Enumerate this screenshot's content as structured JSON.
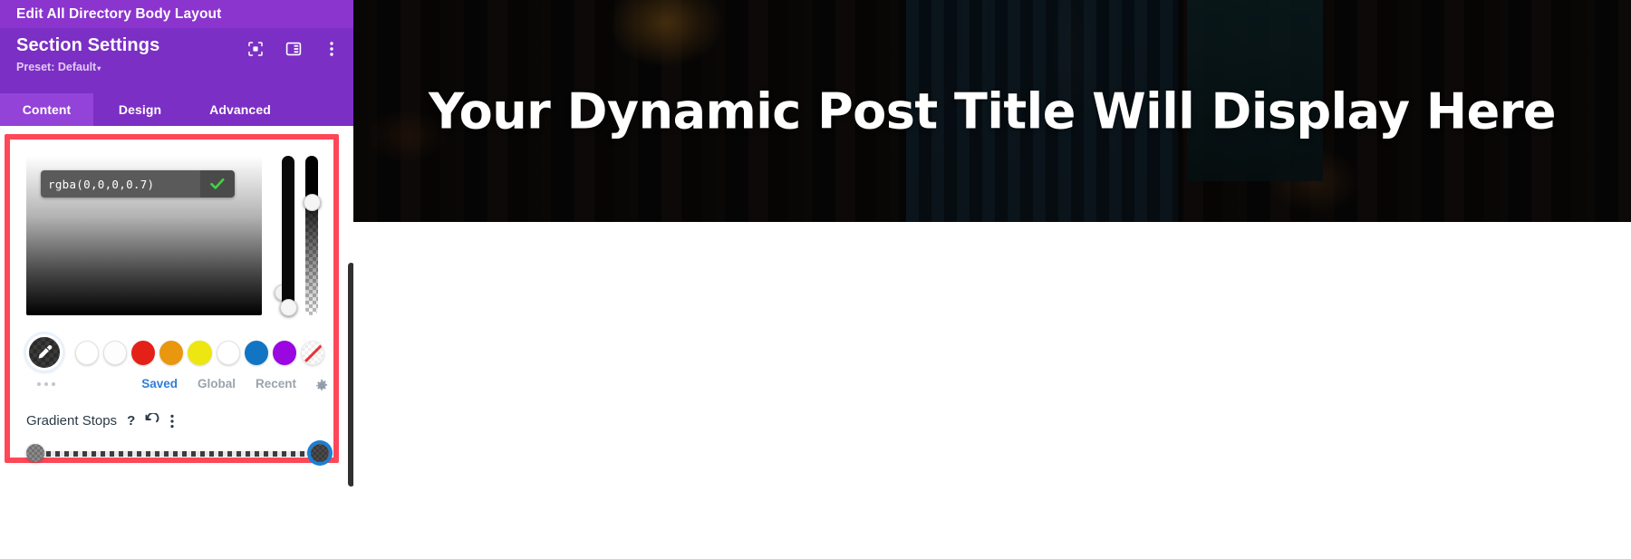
{
  "titlebar": {
    "title": "Edit All Directory Body Layout"
  },
  "panel_header": {
    "heading": "Section Settings",
    "preset": "Preset: Default",
    "caret": "▾",
    "icons": [
      {
        "name": "focus-target-icon"
      },
      {
        "name": "panel-layout-icon"
      },
      {
        "name": "kebab-menu-icon"
      }
    ]
  },
  "tabs": [
    {
      "label": "Content",
      "active": true
    },
    {
      "label": "Design",
      "active": false
    },
    {
      "label": "Advanced",
      "active": false
    }
  ],
  "color_picker": {
    "value": "rgba(0,0,0,0.7)",
    "placeholder": "rgba(0,0,0,0.7)",
    "confirm_icon": "green-checkmark-icon",
    "confirm_color": "#3FD43F",
    "eyedropper_icon": "eyedropper-icon",
    "hue_slider_label": "hue-slider",
    "alpha_slider_label": "alpha-slider",
    "swatches": [
      {
        "name": "swatch-white-1",
        "color": "#ffffff"
      },
      {
        "name": "swatch-white-2",
        "color": "#fdfdfd"
      },
      {
        "name": "swatch-red",
        "color": "#E32119"
      },
      {
        "name": "swatch-orange",
        "color": "#E8970F"
      },
      {
        "name": "swatch-yellow",
        "color": "#EDE611"
      },
      {
        "name": "swatch-white-3",
        "color": "#ffffff"
      },
      {
        "name": "swatch-blue",
        "color": "#1175C4"
      },
      {
        "name": "swatch-purple",
        "color": "#9A07E0"
      }
    ],
    "no_color_swatch": "no-color-swatch",
    "more_dots": "more-options-dots",
    "palette_tabs": [
      {
        "label": "Saved",
        "active": true
      },
      {
        "label": "Global",
        "active": false
      },
      {
        "label": "Recent",
        "active": false
      }
    ],
    "gear_icon": "settings-gear-icon",
    "active_tab_color": "#2F7ED8"
  },
  "gradient_stops": {
    "label": "Gradient Stops",
    "help_icon": "?",
    "reset_icon": "reset-undo-icon",
    "menu_icon": "kebab-menu-icon",
    "stops": [
      {
        "name": "gradient-stop-start",
        "position": 0,
        "selected": false
      },
      {
        "name": "gradient-stop-end",
        "position": 100,
        "selected": true
      }
    ],
    "selected_ring_color": "#1B7FD4"
  },
  "canvas": {
    "hero_title": "Your Dynamic Post Title Will Display Here",
    "hero_overlay": "rgba(0,0,0,0.7)"
  },
  "colors": {
    "titlebar_purple": "#8B34CE",
    "header_purple": "#7B2FC4",
    "active_tab_purple": "#9343D8",
    "highlight_red": "#FF4757"
  }
}
